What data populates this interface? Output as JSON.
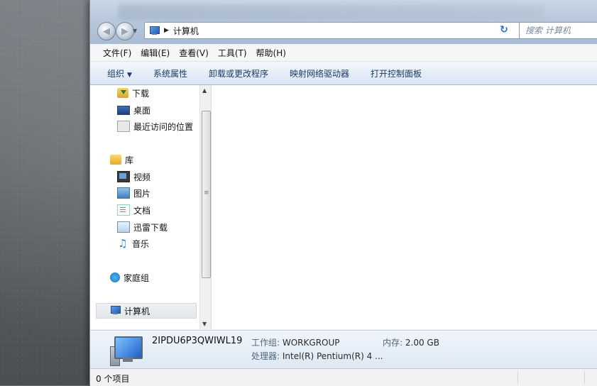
{
  "window": {
    "breadcrumb": "计算机",
    "search": {
      "placeholder": "搜索 计算机"
    }
  },
  "menubar": [
    {
      "label": "文件(F)"
    },
    {
      "label": "编辑(E)"
    },
    {
      "label": "查看(V)"
    },
    {
      "label": "工具(T)"
    },
    {
      "label": "帮助(H)"
    }
  ],
  "toolbar": {
    "organize": "组织",
    "system_properties": "系统属性",
    "uninstall": "卸载或更改程序",
    "map_drive": "映射网络驱动器",
    "control_panel": "打开控制面板"
  },
  "sidebar": {
    "favorites": [
      {
        "label": "下载",
        "icon": "download-icon"
      },
      {
        "label": "桌面",
        "icon": "desktop-icon"
      },
      {
        "label": "最近访问的位置",
        "icon": "recent-places-icon"
      }
    ],
    "libraries": {
      "label": "库",
      "items": [
        {
          "label": "视频",
          "icon": "video-icon"
        },
        {
          "label": "图片",
          "icon": "pictures-icon"
        },
        {
          "label": "文档",
          "icon": "documents-icon"
        },
        {
          "label": "迅雷下载",
          "icon": "thunder-download-icon"
        },
        {
          "label": "音乐",
          "icon": "music-icon"
        }
      ]
    },
    "homegroup": "家庭组",
    "computer": "计算机"
  },
  "details": {
    "computer_name": "2IPDU6P3QWIWL19",
    "workgroup_label": "工作组:",
    "workgroup_value": "WORKGROUP",
    "memory_label": "内存:",
    "memory_value": "2.00 GB",
    "processor_label": "处理器:",
    "processor_value": "Intel(R) Pentium(R) 4 ..."
  },
  "status": {
    "item_count": "0 个项目"
  }
}
